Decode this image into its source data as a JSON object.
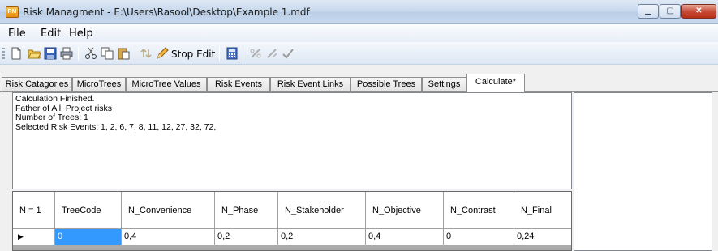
{
  "window": {
    "title": "Risk Managment - E:\\Users\\Rasool\\Desktop\\Example 1.mdf",
    "app_icon_text": "RM"
  },
  "menu": [
    "File",
    "Edit",
    "Help"
  ],
  "toolbar": {
    "stop_edit_label": "Stop Edit"
  },
  "tabs": [
    "Risk Catagories",
    "MicroTrees",
    "MicroTree Values",
    "Risk Events",
    "Risk Event Links",
    "Possible Trees",
    "Settings",
    "Calculate*"
  ],
  "active_tab": "Calculate*",
  "output": {
    "lines": [
      "Calculation Finished.",
      "Father of All: Project risks",
      "Number of Trees: 1",
      "Selected Risk Events: 1, 2, 6, 7, 8, 11, 12, 27, 32, 72,"
    ]
  },
  "grid": {
    "corner": "N = 1",
    "columns": [
      "TreeCode",
      "N_Convenience",
      "N_Phase",
      "N_Stakeholder",
      "N_Objective",
      "N_Contrast",
      "N_Final"
    ],
    "rows": [
      {
        "indicator": "▶",
        "cells": [
          "0",
          "0,4",
          "0,2",
          "0,2",
          "0,4",
          "0",
          "0,24"
        ]
      }
    ]
  },
  "colors": {
    "selection": "#3399ff",
    "titlebar": "#c6d7ec"
  }
}
